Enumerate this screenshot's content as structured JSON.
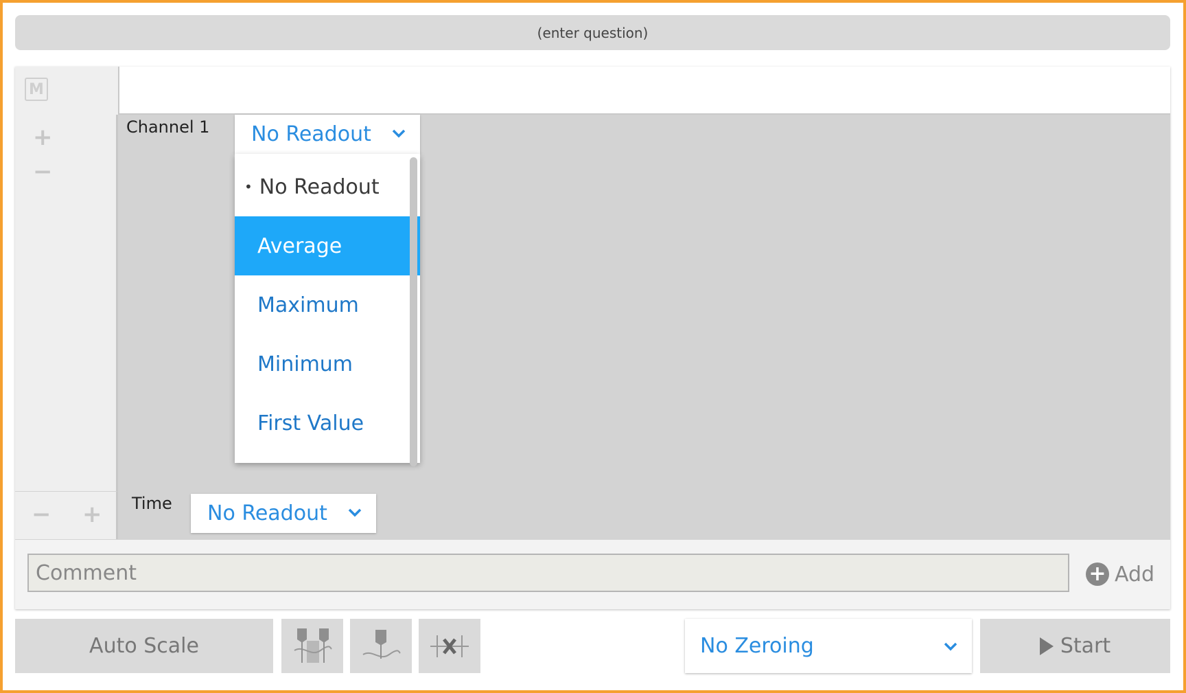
{
  "question": {
    "placeholder_text": "(enter question)"
  },
  "graph": {
    "mode_button": "M",
    "y_zoom_in": "+",
    "y_zoom_out": "−",
    "x_zoom_out": "−",
    "x_zoom_in": "+",
    "channel_label": "Channel 1",
    "channel_readout": "No Readout",
    "time_label": "Time",
    "time_readout": "No Readout"
  },
  "readout_menu": {
    "current": "No Readout",
    "options": [
      "Average",
      "Maximum",
      "Minimum",
      "First Value"
    ],
    "highlighted": "Average"
  },
  "comment": {
    "placeholder": "Comment",
    "add_label": "Add"
  },
  "toolbar": {
    "auto_scale": "Auto Scale",
    "zeroing_selected": "No Zeroing",
    "start": "Start"
  },
  "colors": {
    "accent": "#2a8de0",
    "highlight": "#1ea8f9",
    "frame": "#f5a030"
  }
}
